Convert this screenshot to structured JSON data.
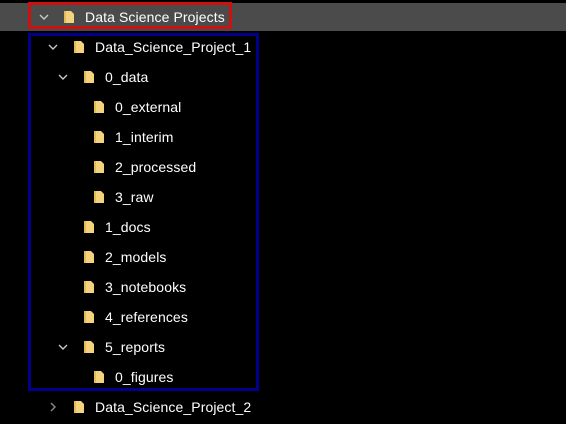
{
  "tree": {
    "root": {
      "label": "Data Science Projects",
      "expanded": true,
      "selected": true
    },
    "items": [
      {
        "label": "Data_Science_Project_1",
        "depth": 1,
        "expanded": true
      },
      {
        "label": "0_data",
        "depth": 2,
        "expanded": true
      },
      {
        "label": "0_external",
        "depth": 3
      },
      {
        "label": "1_interim",
        "depth": 3
      },
      {
        "label": "2_processed",
        "depth": 3
      },
      {
        "label": "3_raw",
        "depth": 3
      },
      {
        "label": "1_docs",
        "depth": 2
      },
      {
        "label": "2_models",
        "depth": 2
      },
      {
        "label": "3_notebooks",
        "depth": 2
      },
      {
        "label": "4_references",
        "depth": 2
      },
      {
        "label": "5_reports",
        "depth": 2,
        "expanded": true
      },
      {
        "label": "0_figures",
        "depth": 3
      },
      {
        "label": "Data_Science_Project_2",
        "depth": 1,
        "expanded": false
      }
    ]
  },
  "colors": {
    "background": "#000000",
    "text": "#ffffff",
    "selected_row": "#4b4b4b",
    "folder_fill": "#f5d37d",
    "folder_shade": "#e2bc58",
    "chevron": "#c8c8c8",
    "annotation_red": "#cc1111",
    "annotation_blue": "#00008b"
  },
  "icons": {
    "expanded": "chevron-down-icon",
    "collapsed": "chevron-right-icon",
    "folder": "folder-icon"
  }
}
